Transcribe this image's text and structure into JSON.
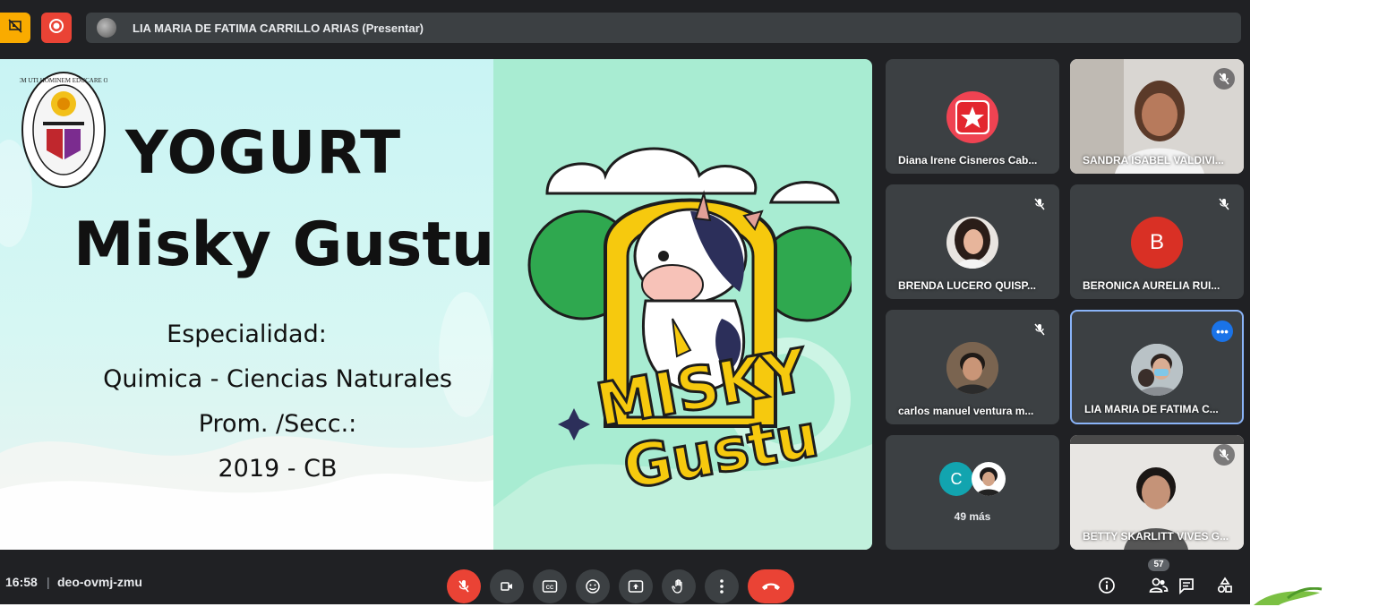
{
  "topbar": {
    "presenter_title": "LIA MARIA DE FATIMA CARRILLO ARIAS (Presentar)"
  },
  "slide": {
    "crest_texts": [
      "HOMINEM UTI HOMINEM EDUCARE OPORTET"
    ],
    "title_line1": "YOGURT",
    "title_line2": "Misky Gustu",
    "especialidad_label": "Especialidad:",
    "especialidad_value": "Quimica - Ciencias Naturales",
    "prom_label": "Prom. /Secc.:",
    "prom_value": "2019 - CB",
    "logo_line1": "MISKY",
    "logo_line2": "Gustu"
  },
  "participants": [
    {
      "name": "Diana Irene Cisneros Cab...",
      "muted": false
    },
    {
      "name": "SANDRA ISABEL VALDIVI...",
      "muted": true
    },
    {
      "name": "BRENDA LUCERO QUISP...",
      "muted": true
    },
    {
      "name": "BERONICA AURELIA RUI...",
      "muted": true,
      "initial": "B"
    },
    {
      "name": "carlos manuel ventura m...",
      "muted": true
    },
    {
      "name": "LIA MARIA DE FATIMA C...",
      "muted": false
    },
    {
      "name": "49 más",
      "initial": "C"
    },
    {
      "name": "BETTY SKARLITT VIVES G...",
      "muted": true
    }
  ],
  "bottombar": {
    "time": "16:58",
    "separator": "|",
    "meeting_code": "deo-ovmj-zmu",
    "participant_count": "57"
  },
  "colors": {
    "background": "#202124",
    "tile": "#3c4043",
    "danger": "#ea4335",
    "active_border": "#8ab4f8",
    "accent_blue": "#1a73e8",
    "badge_orange": "#f9ab00",
    "avatar_b": "#d93025",
    "avatar_c": "#12a4af"
  }
}
